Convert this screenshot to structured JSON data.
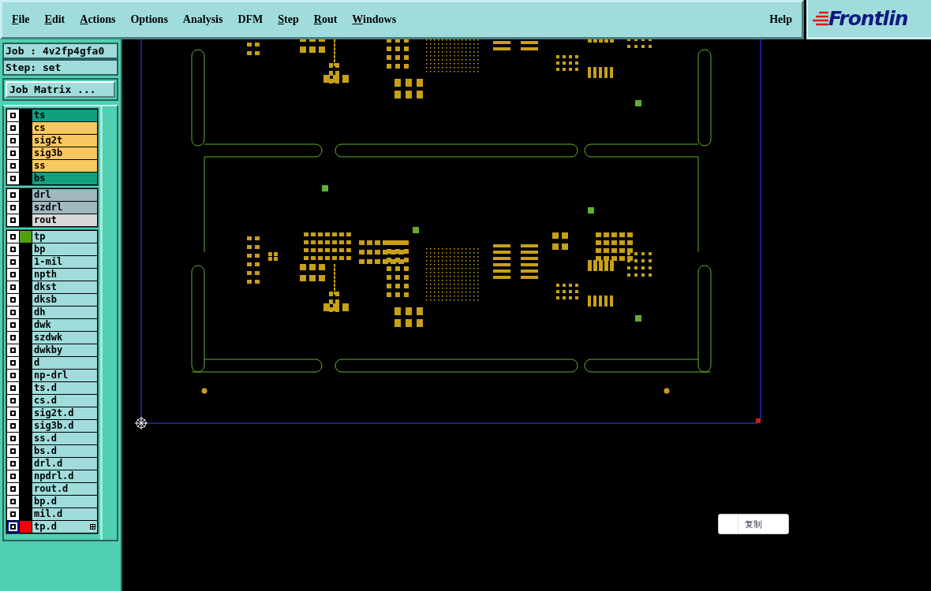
{
  "menu": [
    {
      "label": "File",
      "underline_first": true
    },
    {
      "label": "Edit",
      "underline_first": true
    },
    {
      "label": "Actions",
      "underline_first": true
    },
    {
      "label": "Options",
      "underline_first": false
    },
    {
      "label": "Analysis",
      "underline_first": false
    },
    {
      "label": "DFM",
      "underline_first": false
    },
    {
      "label": "Step",
      "underline_first": true
    },
    {
      "label": "Rout",
      "underline_first": true
    },
    {
      "label": "Windows",
      "underline_first": true
    }
  ],
  "help": "Help",
  "logo": "Frontlin",
  "job": "Job : 4v2fp4gfa0",
  "step": "Step: set",
  "job_matrix_button": "Job Matrix ...",
  "layer_groups": [
    [
      {
        "name": "ts",
        "kind": "mask",
        "selected": false
      },
      {
        "name": "cs",
        "kind": "signal",
        "selected": false
      },
      {
        "name": "sig2t",
        "kind": "signal",
        "selected": false
      },
      {
        "name": "sig3b",
        "kind": "signal",
        "selected": false
      },
      {
        "name": "ss",
        "kind": "signal",
        "selected": false
      },
      {
        "name": "bs",
        "kind": "mask",
        "selected": false
      }
    ],
    [
      {
        "name": "drl",
        "kind": "drill",
        "selected": false
      },
      {
        "name": "szdrl",
        "kind": "drill",
        "selected": false
      },
      {
        "name": "rout",
        "kind": "rout",
        "selected": false
      }
    ],
    [
      {
        "name": "tp",
        "kind": "misc",
        "color": "#50a010",
        "selected": false
      },
      {
        "name": "bp",
        "kind": "misc",
        "selected": false
      },
      {
        "name": "1-mil",
        "kind": "misc",
        "selected": false
      },
      {
        "name": "npth",
        "kind": "misc",
        "selected": false
      },
      {
        "name": "dkst",
        "kind": "misc",
        "selected": false
      },
      {
        "name": "dksb",
        "kind": "misc",
        "selected": false
      },
      {
        "name": "dh",
        "kind": "misc",
        "selected": false
      },
      {
        "name": "dwk",
        "kind": "misc",
        "selected": false
      },
      {
        "name": "szdwk",
        "kind": "misc",
        "selected": false
      },
      {
        "name": "dwkby",
        "kind": "misc",
        "selected": false
      },
      {
        "name": "d",
        "kind": "misc",
        "selected": false
      },
      {
        "name": "np-drl",
        "kind": "misc",
        "selected": false
      },
      {
        "name": "ts.d",
        "kind": "misc",
        "selected": false
      },
      {
        "name": "cs.d",
        "kind": "misc",
        "selected": false
      },
      {
        "name": "sig2t.d",
        "kind": "misc",
        "selected": false
      },
      {
        "name": "sig3b.d",
        "kind": "misc",
        "selected": false
      },
      {
        "name": "ss.d",
        "kind": "misc",
        "selected": false
      },
      {
        "name": "bs.d",
        "kind": "misc",
        "selected": false
      },
      {
        "name": "drl.d",
        "kind": "misc",
        "selected": false
      },
      {
        "name": "npdrl.d",
        "kind": "misc",
        "selected": false
      },
      {
        "name": "rout.d",
        "kind": "misc",
        "selected": false
      },
      {
        "name": "bp.d",
        "kind": "misc",
        "selected": false
      },
      {
        "name": "mil.d",
        "kind": "misc",
        "selected": false
      },
      {
        "name": "tp.d",
        "kind": "misc",
        "color": "#f00000",
        "selected": true
      }
    ]
  ],
  "context_menu": {
    "items": [
      "复制"
    ]
  }
}
